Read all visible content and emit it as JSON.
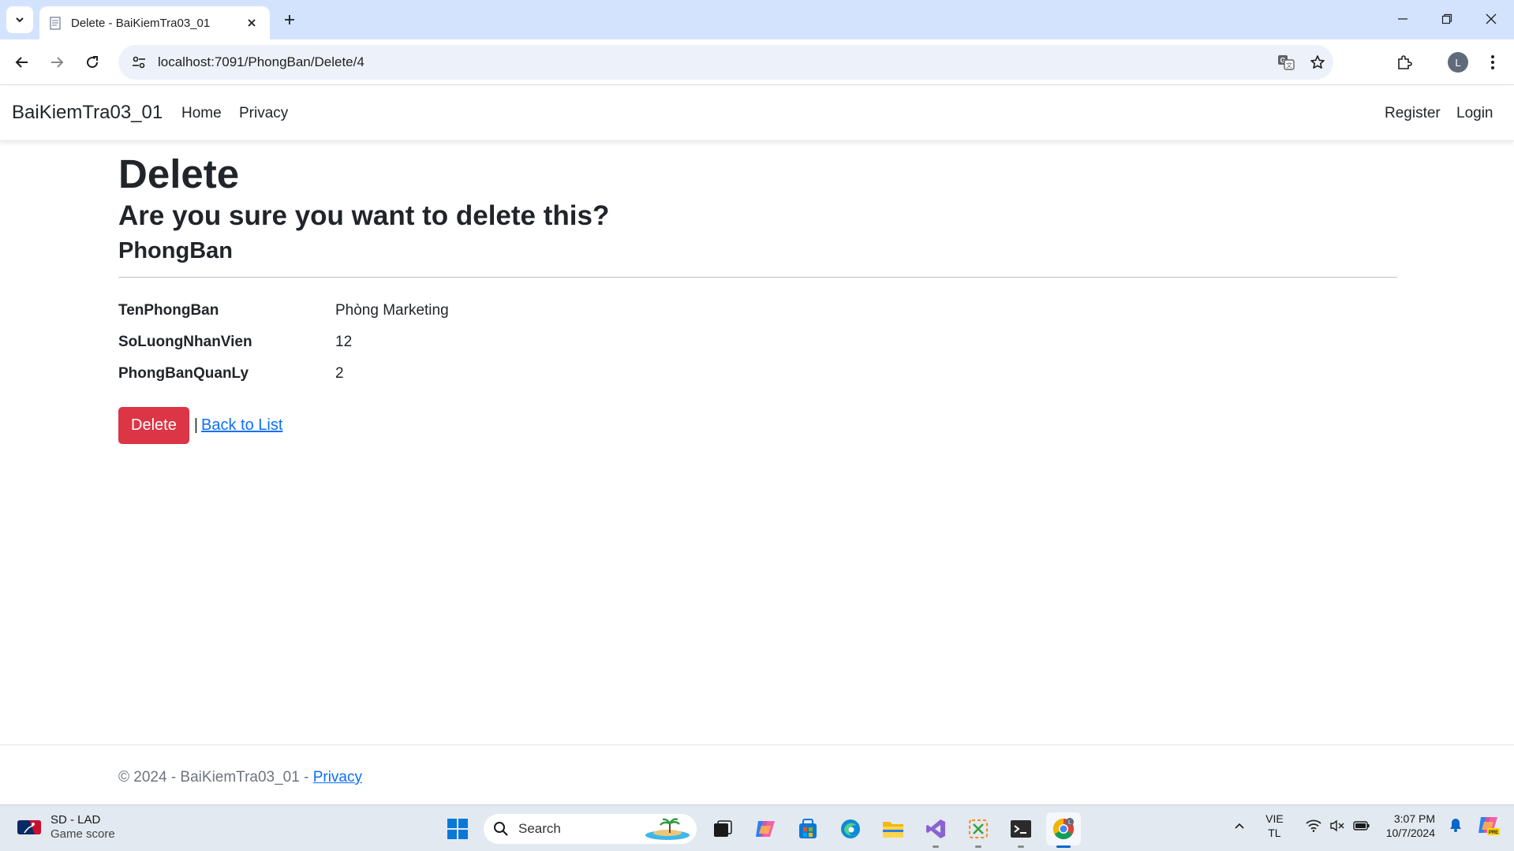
{
  "browser": {
    "tab_title": "Delete - BaiKiemTra03_01",
    "url": "localhost:7091/PhongBan/Delete/4",
    "profile_initial": "L"
  },
  "navbar": {
    "brand": "BaiKiemTra03_01",
    "links": [
      "Home",
      "Privacy"
    ],
    "right_links": [
      "Register",
      "Login"
    ]
  },
  "page": {
    "heading": "Delete",
    "question": "Are you sure you want to delete this?",
    "entity": "PhongBan",
    "fields": [
      {
        "label": "TenPhongBan",
        "value": "Phòng Marketing"
      },
      {
        "label": "SoLuongNhanVien",
        "value": "12"
      },
      {
        "label": "PhongBanQuanLy",
        "value": "2"
      }
    ],
    "delete_label": "Delete",
    "separator": "|",
    "back_label": "Back to List"
  },
  "footer": {
    "text": "© 2024 - BaiKiemTra03_01 - ",
    "privacy": "Privacy"
  },
  "taskbar": {
    "weather_title": "SD - LAD",
    "weather_sub": "Game score",
    "search_placeholder": "Search",
    "lang_top": "VIE",
    "lang_bottom": "TL",
    "time": "3:07 PM",
    "date": "10/7/2024"
  },
  "colors": {
    "danger": "#dc3545",
    "link": "#0d6efd",
    "tabstrip": "#d3e3fd"
  }
}
